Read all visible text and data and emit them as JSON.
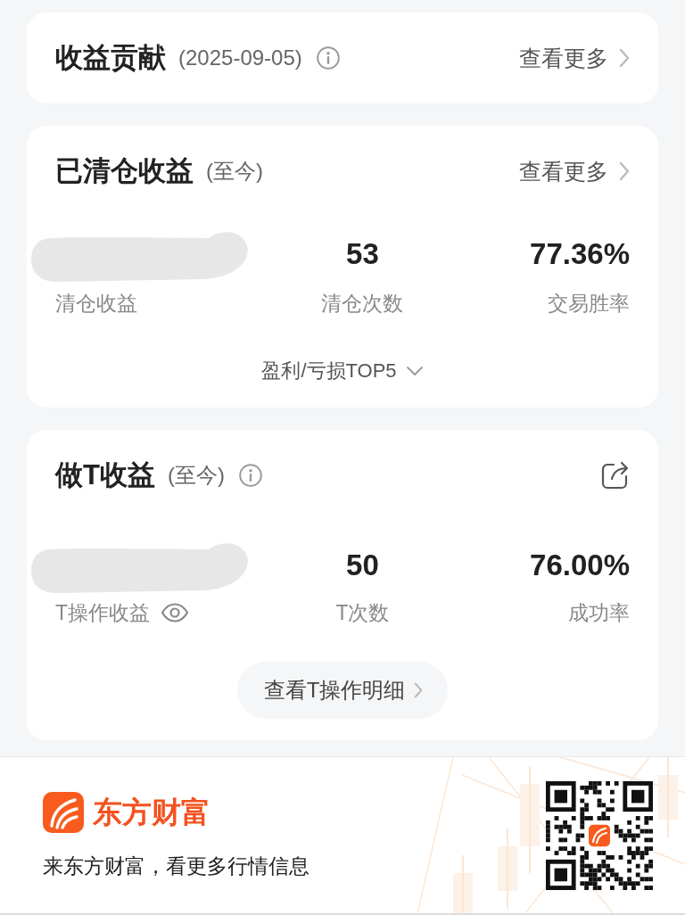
{
  "cards": [
    {
      "kind": "summary",
      "title": "收益贡献",
      "subtitle": "(2025-09-05)",
      "info_icon": true,
      "more_link": "查看更多"
    },
    {
      "kind": "stats",
      "title": "已清仓收益",
      "subtitle": "(至今)",
      "info_icon": false,
      "more_link": "查看更多",
      "stats": [
        {
          "label": "清仓收益",
          "masked": true
        },
        {
          "value": "53",
          "label": "清仓次数"
        },
        {
          "value": "77.36%",
          "label": "交易胜率"
        }
      ],
      "toggle": {
        "label": "盈利/亏损TOP5",
        "expanded": false
      }
    },
    {
      "kind": "stats",
      "title": "做T收益",
      "subtitle": "(至今)",
      "info_icon": true,
      "share_icon": true,
      "stats": [
        {
          "label": "T操作收益",
          "masked": true,
          "visibility_toggle": true
        },
        {
          "value": "50",
          "label": "T次数"
        },
        {
          "value": "76.00%",
          "label": "成功率"
        }
      ],
      "button": "查看T操作明细"
    }
  ],
  "footer": {
    "brand": "东方财富",
    "tagline": "来东方财富，看更多行情信息"
  }
}
